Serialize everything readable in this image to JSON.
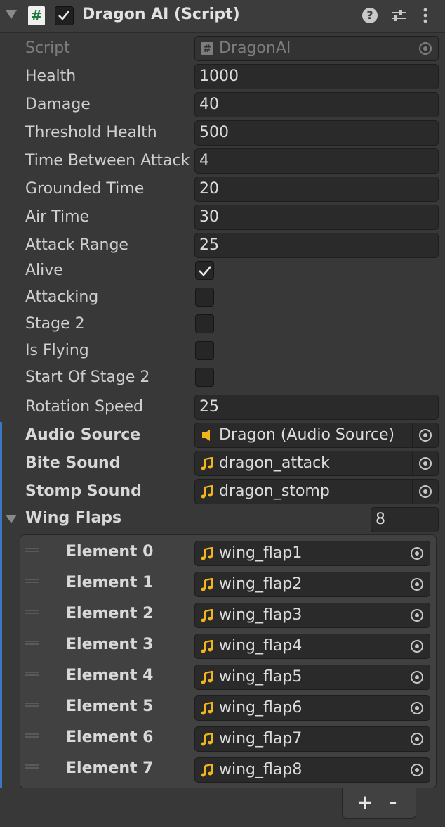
{
  "component": {
    "title": "Dragon AI (Script)",
    "script_label": "Script",
    "script_value": "DragonAI",
    "icons": [
      "foldout-arrow-icon",
      "csharp-script-icon",
      "enabled-checkbox-icon",
      "help-icon",
      "preset-icon",
      "kebab-menu-icon"
    ]
  },
  "fields": {
    "health": {
      "label": "Health",
      "value": "1000"
    },
    "damage": {
      "label": "Damage",
      "value": "40"
    },
    "threshold_health": {
      "label": "Threshold Health",
      "value": "500"
    },
    "time_between_attack": {
      "label": "Time Between Attack",
      "value": "4"
    },
    "grounded_time": {
      "label": "Grounded Time",
      "value": "20"
    },
    "air_time": {
      "label": "Air Time",
      "value": "30"
    },
    "attack_range": {
      "label": "Attack Range",
      "value": "25"
    },
    "alive": {
      "label": "Alive",
      "checked": true
    },
    "attacking": {
      "label": "Attacking",
      "checked": false
    },
    "stage2": {
      "label": "Stage 2",
      "checked": false
    },
    "is_flying": {
      "label": "Is Flying",
      "checked": false
    },
    "start_of_stage2": {
      "label": "Start Of Stage 2",
      "checked": false
    },
    "rotation_speed": {
      "label": "Rotation Speed",
      "value": "25"
    },
    "audio_source": {
      "label": "Audio Source",
      "value": "Dragon (Audio Source)"
    },
    "bite_sound": {
      "label": "Bite Sound",
      "value": "dragon_attack"
    },
    "stomp_sound": {
      "label": "Stomp Sound",
      "value": "dragon_stomp"
    }
  },
  "wing_flaps": {
    "label": "Wing Flaps",
    "size": "8",
    "elements": [
      {
        "label": "Element 0",
        "value": "wing_flap1"
      },
      {
        "label": "Element 1",
        "value": "wing_flap2"
      },
      {
        "label": "Element 2",
        "value": "wing_flap3"
      },
      {
        "label": "Element 3",
        "value": "wing_flap4"
      },
      {
        "label": "Element 4",
        "value": "wing_flap5"
      },
      {
        "label": "Element 5",
        "value": "wing_flap6"
      },
      {
        "label": "Element 6",
        "value": "wing_flap7"
      },
      {
        "label": "Element 7",
        "value": "wing_flap8"
      }
    ],
    "add_label": "+",
    "remove_label": "-"
  },
  "colors": {
    "background": "#383838",
    "field": "#2a2a2a",
    "audio_icon": "#f2b51b",
    "modified_bar": "#3a79c2"
  }
}
